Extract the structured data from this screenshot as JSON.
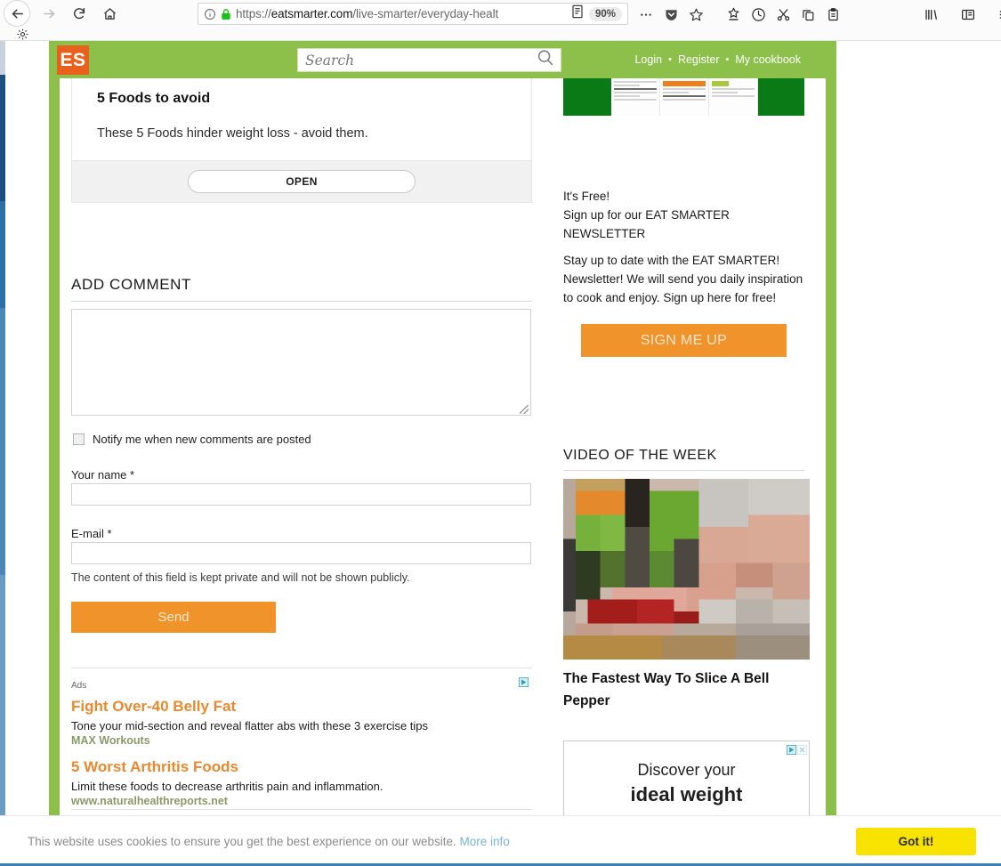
{
  "browser": {
    "url_scheme": "https://",
    "url_host": "eatsmarter.com",
    "url_path": "/live-smarter/everyday-healt",
    "zoom_level": "90%",
    "back_icon": "back-arrow-icon",
    "forward_icon": "forward-arrow-icon",
    "reload_icon": "reload-icon",
    "home_icon": "home-icon",
    "gear_icon": "gear-icon",
    "identity_icon": "page-info-icon",
    "lock_icon": "padlock-icon",
    "reader_icon": "reader-view-icon",
    "toolbar_icons": [
      "ellipsis-icon",
      "pocket-shield-icon",
      "star-bookmark-icon",
      "bookmark-star-icon",
      "history-clock-icon",
      "scissors-cut-icon",
      "copy-icon",
      "clipboard-paste-icon"
    ],
    "far_icons": [
      "library-icon",
      "sidebar-icon",
      "hamburger-menu-icon"
    ]
  },
  "site": {
    "logo_text": "ES",
    "search_placeholder": "Search",
    "search_icon": "magnifier-icon",
    "nav": [
      {
        "label": "Login"
      },
      {
        "label": "Register"
      },
      {
        "label": "My cookbook"
      }
    ],
    "nav_separator": "•"
  },
  "main": {
    "promo": {
      "title": "5 Foods to avoid",
      "subtitle": "These 5 Foods hinder weight loss - avoid them.",
      "button": "OPEN"
    },
    "comment": {
      "heading": "ADD COMMENT",
      "textarea_value": "",
      "notify_label": "Notify me when new comments are posted",
      "notify_checked": false,
      "name_label": "Your name *",
      "name_value": "",
      "email_label": "E-mail *",
      "email_value": "",
      "email_note": "The content of this field is kept private and will not be shown publicly.",
      "send_label": "Send"
    },
    "ads": {
      "label": "Ads",
      "info_icon": "adchoices-icon",
      "items": [
        {
          "title": "Fight Over-40 Belly Fat",
          "desc": "Tone your mid-section and reveal flatter abs with these 3 exercise tips",
          "source": "MAX Workouts"
        },
        {
          "title": "5 Worst Arthritis Foods",
          "desc": "Limit these foods to decrease arthritis pain and inflammation.",
          "source": "www.naturalhealthreports.net"
        }
      ]
    }
  },
  "sidebar": {
    "newsletter": {
      "line1": "It's Free!",
      "line2": "Sign up for our EAT SMARTER NEWSLETTER",
      "body": "Stay up to date with the EAT SMARTER! Newsletter! We will send you daily inspiration to cook and enjoy. Sign up here for free!",
      "button": "SIGN ME UP"
    },
    "video": {
      "heading": "VIDEO OF THE WEEK",
      "title": "The Fastest Way To Slice A Bell Pepper",
      "thumb_alt": "bell-pepper-video-thumbnail"
    },
    "bottom_ad": {
      "line1": "Discover your",
      "line2": "ideal weight",
      "adchoices_icon": "adchoices-icon",
      "close_icon": "close-icon"
    }
  },
  "cookie_bar": {
    "message": "This website uses cookies to ensure you get the best experience on our website.",
    "more_info": "More info",
    "accept_label": "Got it!"
  },
  "colors": {
    "brand_green": "#8cc04a",
    "logo_orange": "#e8601c",
    "button_orange": "#f0932b",
    "ad_title_orange": "#e8892f",
    "cookie_yellow": "#f7e200",
    "banner_green": "#0a7a17"
  }
}
